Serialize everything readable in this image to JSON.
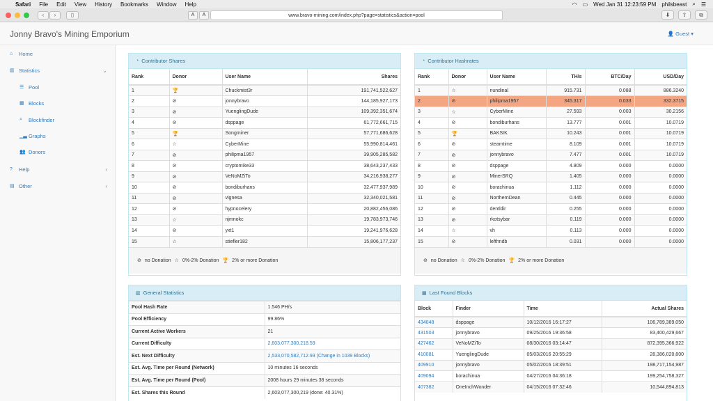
{
  "macbar": {
    "apple": "",
    "app": "Safari",
    "menus": [
      "File",
      "Edit",
      "View",
      "History",
      "Bookmarks",
      "Window",
      "Help"
    ],
    "datetime": "Wed Jan 31  12:23:59 PM",
    "user": "philsbeast"
  },
  "browser": {
    "url": "www.bravo-mining.com/index.php?page=statistics&action=pool",
    "font_small": "A",
    "font_large": "A"
  },
  "header": {
    "brand": "Jonny Bravo's Mining Emporium",
    "guest": "Guest"
  },
  "sidebar": {
    "home": "Home",
    "statistics": "Statistics",
    "pool": "Pool",
    "blocks": "Blocks",
    "blockfinder": "Blockfinder",
    "graphs": "Graphs",
    "donors": "Donors",
    "help": "Help",
    "other": "Other"
  },
  "shares": {
    "title": "Contributor Shares",
    "headers": [
      "Rank",
      "Donor",
      "User Name",
      "Shares"
    ],
    "rows": [
      [
        "1",
        "trophy",
        "Chuckmist3r",
        "191,741,522,627"
      ],
      [
        "2",
        "none",
        "jonnybravo",
        "144,185,927,173"
      ],
      [
        "3",
        "none",
        "YuenglingDude",
        "109,392,351,674"
      ],
      [
        "4",
        "none",
        "dsppage",
        "61,772,661,715"
      ],
      [
        "5",
        "trophy",
        "Songminer",
        "57,771,686,628"
      ],
      [
        "6",
        "star",
        "CyberMine",
        "55,990,814,461"
      ],
      [
        "7",
        "none",
        "philipma1957",
        "39,905,285,582"
      ],
      [
        "8",
        "none",
        "cryptomike33",
        "38,643,237,433"
      ],
      [
        "9",
        "none",
        "VeNoMZiTo",
        "34,216,938,277"
      ],
      [
        "10",
        "none",
        "bondiburhans",
        "32,477,937,989"
      ],
      [
        "11",
        "none",
        "vignesa",
        "32,340,021,581"
      ],
      [
        "12",
        "none",
        "hypnocelery",
        "20,882,456,086"
      ],
      [
        "13",
        "star",
        "njmnokc",
        "19,783,973,746"
      ],
      [
        "14",
        "none",
        "yxt1",
        "19,241,976,628"
      ],
      [
        "15",
        "star",
        "stiefler182",
        "15,806,177,237"
      ]
    ],
    "legend": {
      "no_donation": "no Donation",
      "low_donation": "0%-2% Donation",
      "high_donation": "2% or more Donation"
    }
  },
  "hashrates": {
    "title": "Contributor Hashrates",
    "headers": [
      "Rank",
      "Donor",
      "User Name",
      "TH/s",
      "BTC/Day",
      "USD/Day"
    ],
    "rows": [
      [
        "1",
        "star",
        "nundinal",
        "915.731",
        "0.088",
        "886.3240"
      ],
      [
        "2",
        "none",
        "philipma1957",
        "345.317",
        "0.033",
        "332.3715"
      ],
      [
        "3",
        "star",
        "CyberMine",
        "27.593",
        "0.003",
        "30.2156"
      ],
      [
        "4",
        "none",
        "bondiburhans",
        "13.777",
        "0.001",
        "10.0719"
      ],
      [
        "5",
        "trophy",
        "BAKSIK",
        "10.243",
        "0.001",
        "10.0719"
      ],
      [
        "6",
        "none",
        "steamtime",
        "8.109",
        "0.001",
        "10.0719"
      ],
      [
        "7",
        "none",
        "jonnybravo",
        "7.477",
        "0.001",
        "10.0719"
      ],
      [
        "8",
        "none",
        "dsppage",
        "4.809",
        "0.000",
        "0.0000"
      ],
      [
        "9",
        "none",
        "MinerSRQ",
        "1.405",
        "0.000",
        "0.0000"
      ],
      [
        "10",
        "none",
        "borachinua",
        "1.112",
        "0.000",
        "0.0000"
      ],
      [
        "11",
        "none",
        "NorthernDean",
        "0.445",
        "0.000",
        "0.0000"
      ],
      [
        "12",
        "none",
        "dentldir",
        "0.255",
        "0.000",
        "0.0000"
      ],
      [
        "13",
        "none",
        "rkotsybar",
        "0.119",
        "0.000",
        "0.0000"
      ],
      [
        "14",
        "star",
        "vh",
        "0.113",
        "0.000",
        "0.0000"
      ],
      [
        "15",
        "none",
        "lefthndb",
        "0.031",
        "0.000",
        "0.0000"
      ]
    ],
    "highlight_row": 2,
    "highlight_color": "#f4a582",
    "legend": {
      "no_donation": "no Donation",
      "low_donation": "0%-2% Donation",
      "high_donation": "2% or more Donation"
    }
  },
  "general": {
    "title": "General Statistics",
    "rows": [
      [
        "Pool Hash Rate",
        "1.546 PH/s"
      ],
      [
        "Pool Efficiency",
        "99.86%"
      ],
      [
        "Current Active Workers",
        "21"
      ],
      [
        "Current Difficulty",
        "2,603,077,300,218.59"
      ],
      [
        "Est. Next Difficulty",
        "2,533,070,582,712.93 (Change in 1039 Blocks)"
      ],
      [
        "Est. Avg. Time per Round (Network)",
        "10 minutes 16 seconds"
      ],
      [
        "Est. Avg. Time per Round (Pool)",
        "2008 hours 29 minutes 38 seconds"
      ],
      [
        "Est. Shares this Round",
        "2,603,077,300,219 (done: 40.31%)"
      ]
    ]
  },
  "blocks": {
    "title": "Last Found Blocks",
    "headers": [
      "Block",
      "Finder",
      "Time",
      "Actual Shares"
    ],
    "rows": [
      [
        "434048",
        "dsppage",
        "10/12/2016 16:17:27",
        "106,789,389,050"
      ],
      [
        "431503",
        "jonnybravo",
        "09/25/2016 19:36:58",
        "83,400,429,667"
      ],
      [
        "427462",
        "VeNoMZiTo",
        "08/30/2016 03:14:47",
        "872,395,366,922"
      ],
      [
        "410081",
        "YuenglingDude",
        "05/03/2016 20:55:29",
        "28,386,020,800"
      ],
      [
        "409910",
        "jonnybravo",
        "05/02/2016 18:39:51",
        "198,717,154,987"
      ],
      [
        "409094",
        "borachinua",
        "04/27/2016 04:36:18",
        "199,254,758,327"
      ],
      [
        "407382",
        "OneInchWonder",
        "04/15/2016 07:32:46",
        "10,544,894,813"
      ]
    ]
  },
  "colors": {
    "accent": "#337ab7",
    "panel_head": "#d9edf7",
    "panel_border": "#bce8f1"
  }
}
